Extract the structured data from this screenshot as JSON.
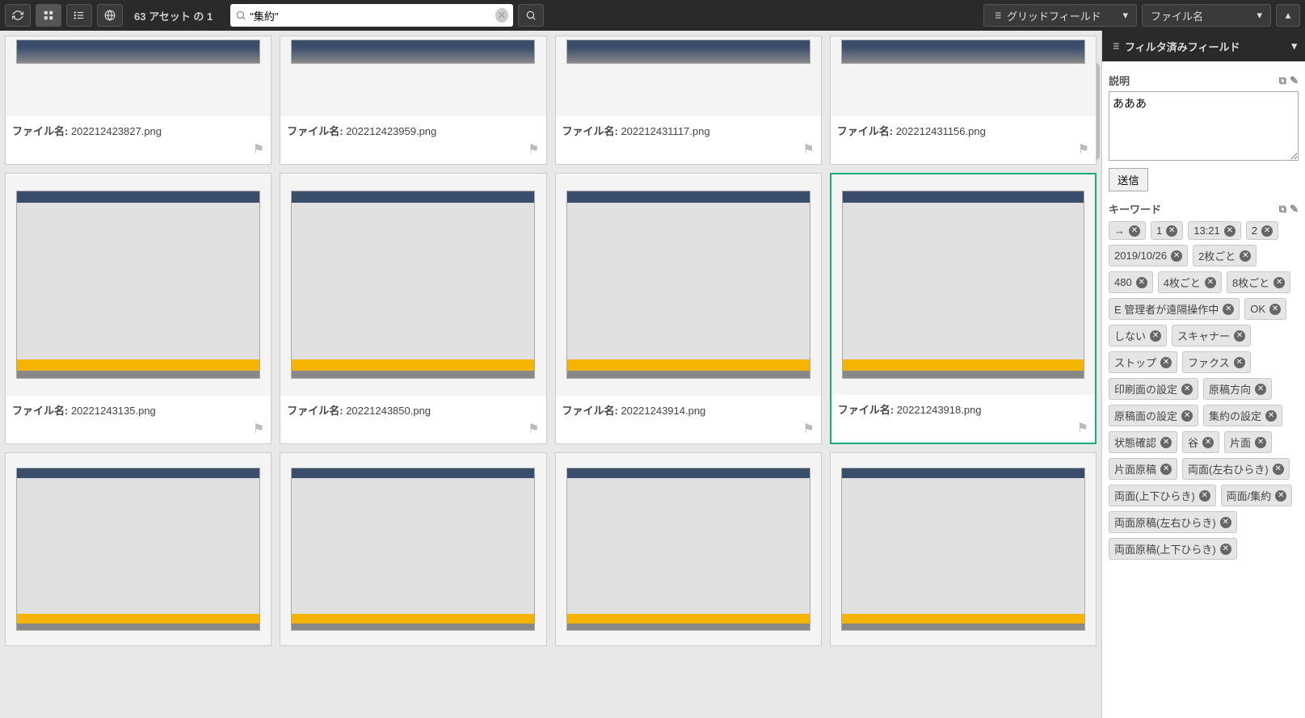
{
  "header": {
    "counter": "63 アセット の 1",
    "searchValue": "\"集約\"",
    "gridFieldLabel": "グリッドフィールド",
    "sortLabel": "ファイル名",
    "filterPanelLabel": "フィルタ済みフィールド"
  },
  "assets": {
    "row1": [
      {
        "fileLabel": "ファイル名:",
        "fileName": "202212423827.png"
      },
      {
        "fileLabel": "ファイル名:",
        "fileName": "202212423959.png"
      },
      {
        "fileLabel": "ファイル名:",
        "fileName": "202212431117.png"
      },
      {
        "fileLabel": "ファイル名:",
        "fileName": "202212431156.png"
      }
    ],
    "row2": [
      {
        "fileLabel": "ファイル名:",
        "fileName": "20221243135.png"
      },
      {
        "fileLabel": "ファイル名:",
        "fileName": "20221243850.png"
      },
      {
        "fileLabel": "ファイル名:",
        "fileName": "20221243914.png"
      },
      {
        "fileLabel": "ファイル名:",
        "fileName": "20221243918.png"
      }
    ]
  },
  "sidebar": {
    "descLabel": "説明",
    "descValue": "あああ",
    "submit": "送信",
    "keywordsLabel": "キーワード",
    "tags": [
      "→",
      "1",
      "13:21",
      "2",
      "2019/10/26",
      "2枚ごと",
      "480",
      "4枚ごと",
      "8枚ごと",
      "E 管理者が遠隔操作中",
      "OK",
      "しない",
      "スキャナー",
      "ストップ",
      "ファクス",
      "印刷面の設定",
      "原稿方向",
      "原稿面の設定",
      "集約の設定",
      "状態確認",
      "谷",
      "片面",
      "片面原稿",
      "両面(左右ひらき)",
      "両面(上下ひらき)",
      "両面/集約",
      "両面原稿(左右ひらき)",
      "両面原稿(上下ひらき)"
    ]
  }
}
